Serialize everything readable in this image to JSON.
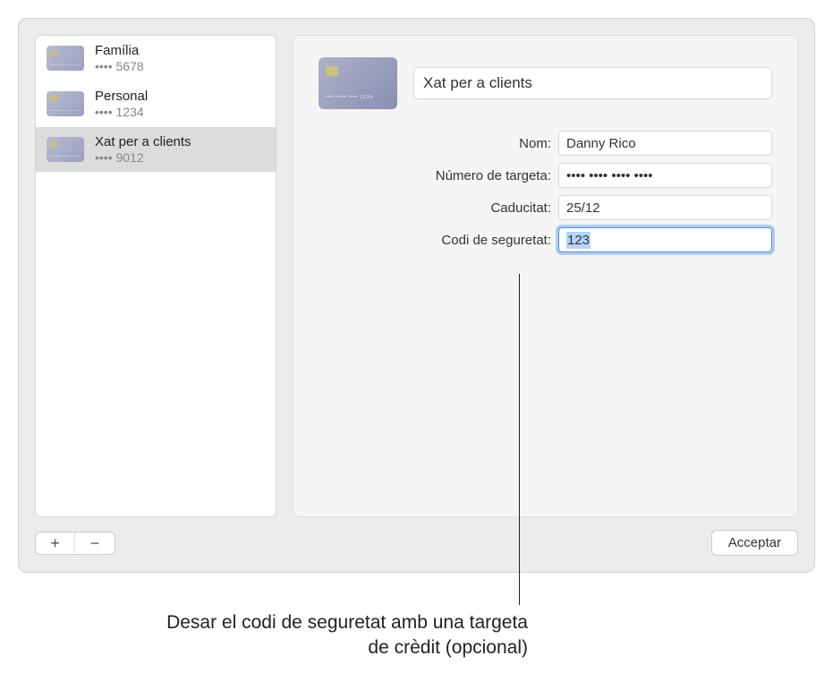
{
  "sidebar": {
    "items": [
      {
        "title": "Família",
        "masked": "•••• 5678",
        "selected": false
      },
      {
        "title": "Personal",
        "masked": "•••• 1234",
        "selected": false
      },
      {
        "title": "Xat per a clients",
        "masked": "•••• 9012",
        "selected": true
      }
    ]
  },
  "detail": {
    "title_value": "Xat per a clients",
    "fields": {
      "name": {
        "label": "Nom:",
        "value": "Danny Rico"
      },
      "number": {
        "label": "Número de targeta:",
        "value": "•••• •••• •••• ••••"
      },
      "expiry": {
        "label": "Caducitat:",
        "value": "25/12"
      },
      "security": {
        "label": "Codi de seguretat:",
        "value": "123"
      }
    }
  },
  "buttons": {
    "add": "+",
    "remove": "−",
    "accept": "Acceptar"
  },
  "callout": "Desar el codi de seguretat amb una targeta de crèdit (opcional)"
}
